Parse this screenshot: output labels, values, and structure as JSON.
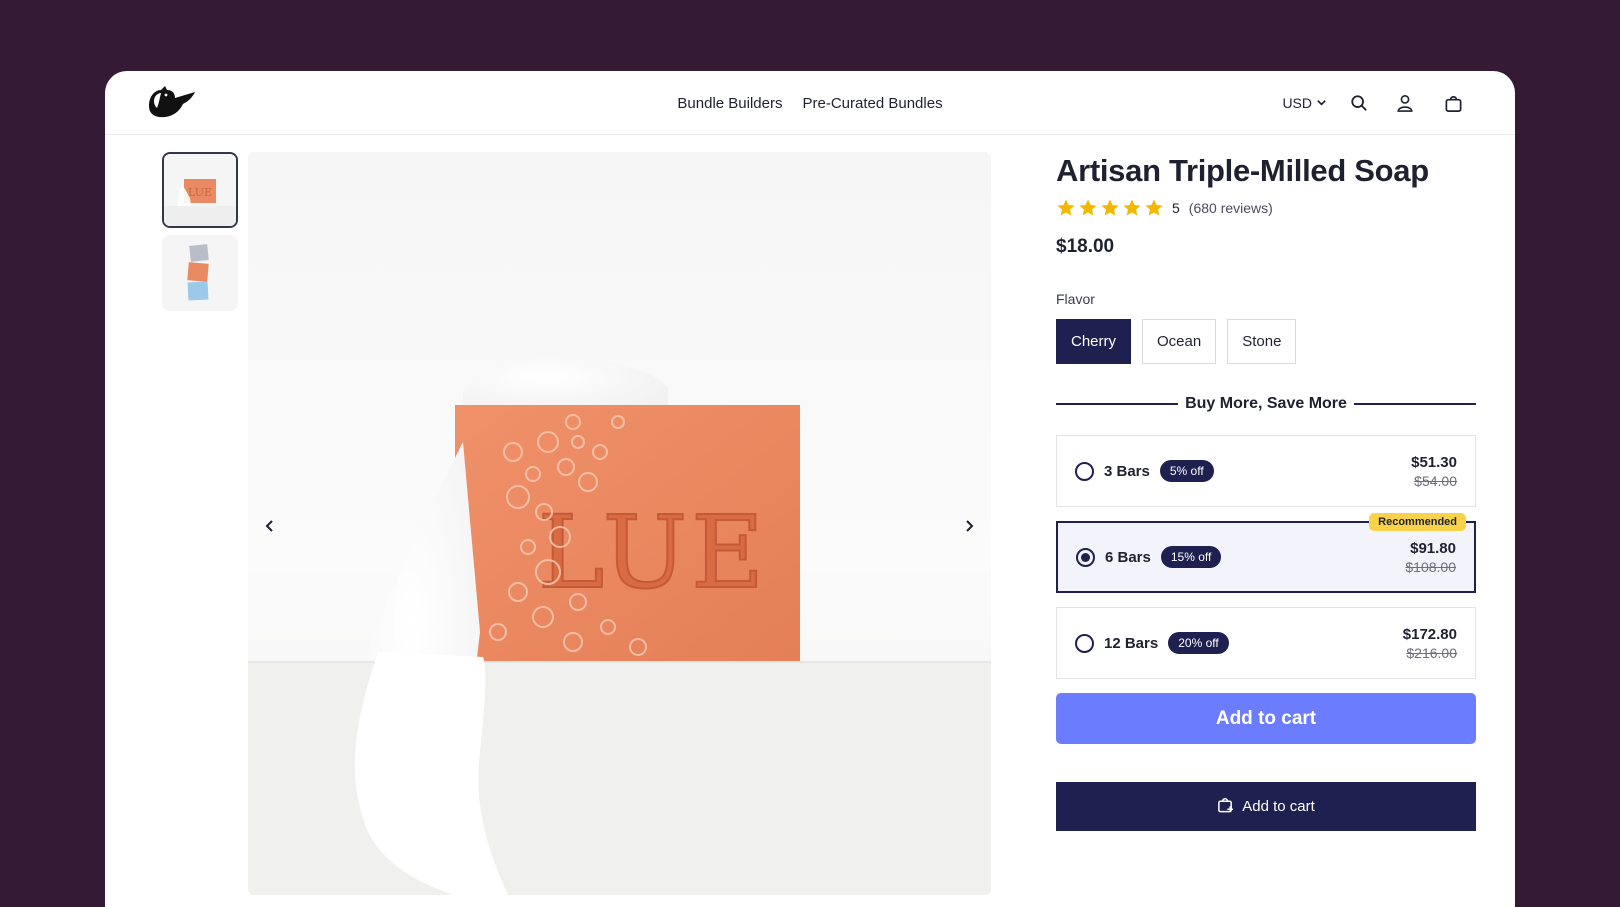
{
  "nav": {
    "links": [
      "Bundle Builders",
      "Pre-Curated Bundles"
    ],
    "currency": "USD",
    "icons": [
      "search-icon",
      "account-icon",
      "cart-icon"
    ]
  },
  "gallery": {
    "thumbnails": 2,
    "active_thumbnail": 1
  },
  "product": {
    "title": "Artisan Triple-Milled Soap",
    "rating": "5",
    "rating_stars": 5,
    "reviews": "(680 reviews)",
    "price": "$18.00",
    "flavor_label": "Flavor",
    "flavors": [
      "Cherry",
      "Ocean",
      "Stone"
    ],
    "selected_flavor": "Cherry",
    "bundle_heading": "Buy More, Save More",
    "tiers": [
      {
        "label": "3 Bars",
        "discount": "5% off",
        "price": "$51.30",
        "compare": "$54.00"
      },
      {
        "label": "6 Bars",
        "discount": "15% off",
        "price": "$91.80",
        "compare": "$108.00",
        "tag": "Recommended"
      },
      {
        "label": "12 Bars",
        "discount": "20% off",
        "price": "$172.80",
        "compare": "$216.00"
      }
    ],
    "selected_tier": "6 Bars",
    "add_to_cart_primary": "Add to cart",
    "add_to_cart_secondary": "Add to cart"
  },
  "colors": {
    "background": "#351a36",
    "navy": "#1e2150",
    "accent": "#6b7cff",
    "recommended": "#f7d24a",
    "star": "#f5b800",
    "soap": "#e98a63"
  }
}
